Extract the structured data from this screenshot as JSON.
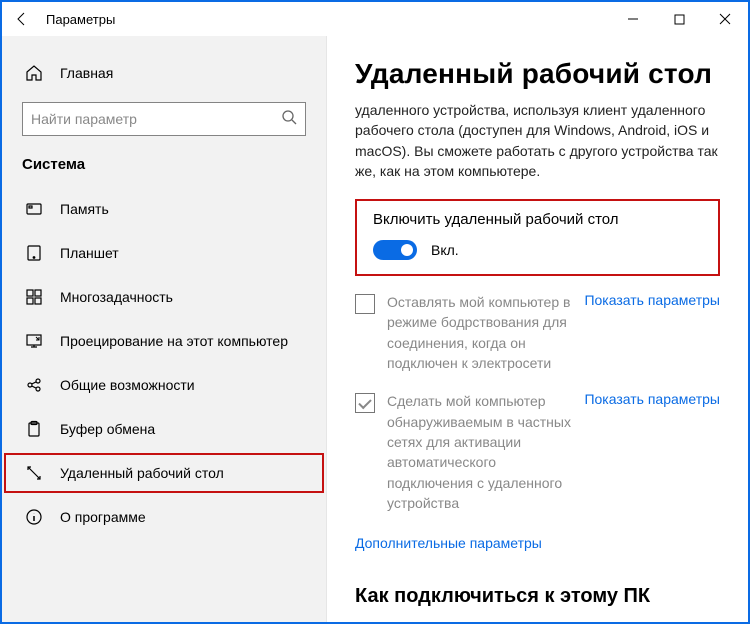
{
  "titlebar": {
    "title": "Параметры"
  },
  "sidebar": {
    "home_label": "Главная",
    "search_placeholder": "Найти параметр",
    "section": "Система",
    "items": [
      {
        "label": "Память"
      },
      {
        "label": "Планшет"
      },
      {
        "label": "Многозадачность"
      },
      {
        "label": "Проецирование на этот компьютер"
      },
      {
        "label": "Общие возможности"
      },
      {
        "label": "Буфер обмена"
      },
      {
        "label": "Удаленный рабочий стол"
      },
      {
        "label": "О программе"
      }
    ]
  },
  "main": {
    "page_title": "Удаленный рабочий стол",
    "desc": "удаленного устройства, используя клиент удаленного рабочего стола (доступен для Windows, Android, iOS и macOS). Вы сможете работать с другого устройства так же, как на этом компьютере.",
    "toggle_title": "Включить удаленный рабочий стол",
    "toggle_state": "Вкл.",
    "opt1": "Оставлять мой компьютер в режиме бодрствования для соединения, когда он подключен к электросети",
    "opt2": "Сделать мой компьютер обнаруживаемым в частных сетях для активации автоматического подключения с удаленного устройства",
    "link_text": "Показать параметры",
    "extra_link": "Дополнительные параметры",
    "subhead": "Как подключиться к этому ПК"
  }
}
